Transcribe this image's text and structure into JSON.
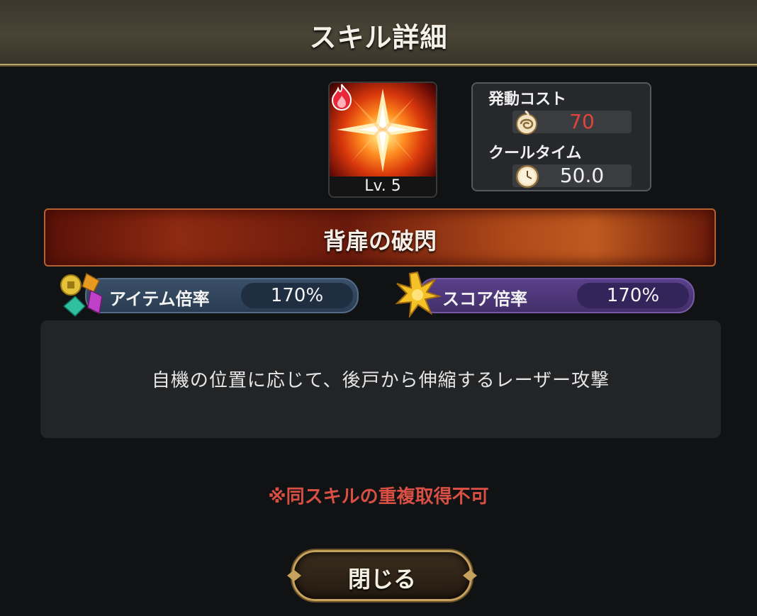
{
  "header": {
    "title": "スキル詳細"
  },
  "skill": {
    "level_label": "Lv. 5",
    "name": "背扉の破閃",
    "element_icon": "fire-icon",
    "description": "自機の位置に応じて、後戸から伸縮するレーザー攻撃",
    "note": "※同スキルの重複取得不可"
  },
  "cost": {
    "activation_label": "発動コスト",
    "activation_value": "70",
    "activation_icon": "swirl-cost-icon",
    "cooldown_label": "クールタイム",
    "cooldown_value": "50.0",
    "cooldown_icon": "clock-icon",
    "activation_color": "#e0443a"
  },
  "multipliers": {
    "item_label": "アイテム倍率",
    "item_value": "170%",
    "item_icon": "gems-icon",
    "score_label": "スコア倍率",
    "score_value": "170%",
    "score_icon": "star-burst-icon"
  },
  "buttons": {
    "close_label": "閉じる"
  }
}
